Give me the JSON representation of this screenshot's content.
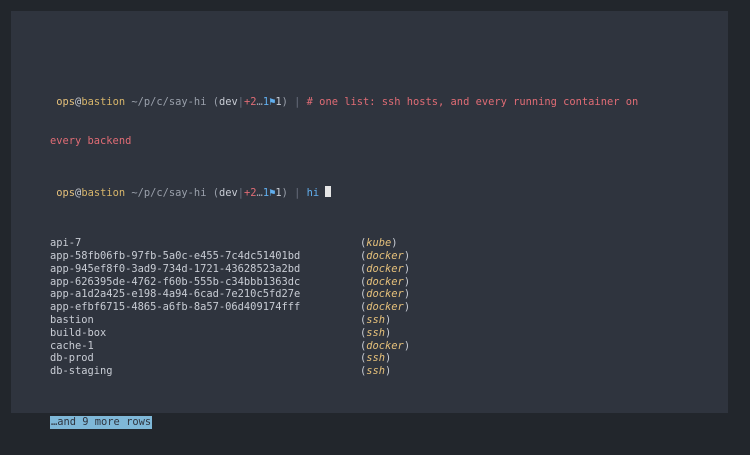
{
  "prompt1": {
    "user": "ops",
    "at": "@",
    "host": "bastion",
    "path": "~/p/c/say-hi",
    "branch": "dev",
    "ahead": "+2",
    "dots": "…",
    "behind": "1",
    "staged": "1",
    "pipe": "|",
    "comment": "# one list: ssh hosts, and every running container on",
    "comment_wrap": "every backend"
  },
  "prompt2": {
    "user": "ops",
    "at": "@",
    "host": "bastion",
    "path": "~/p/c/say-hi",
    "branch": "dev",
    "ahead": "+2",
    "dots": "…",
    "behind": "1",
    "staged": "1",
    "pipe": "|",
    "command": "hi"
  },
  "rows": [
    {
      "name": "api-7",
      "type": "kube"
    },
    {
      "name": "app-58fb06fb-97fb-5a0c-e455-7c4dc51401bd",
      "type": "docker"
    },
    {
      "name": "app-945ef8f0-3ad9-734d-1721-43628523a2bd",
      "type": "docker"
    },
    {
      "name": "app-626395de-4762-f60b-555b-c34bbb1363dc",
      "type": "docker"
    },
    {
      "name": "app-a1d2a425-e198-4a94-6cad-7e210c5fd27e",
      "type": "docker"
    },
    {
      "name": "app-efbf6715-4865-a6fb-8a57-06d409174fff",
      "type": "docker"
    },
    {
      "name": "bastion",
      "type": "ssh"
    },
    {
      "name": "build-box",
      "type": "ssh"
    },
    {
      "name": "cache-1",
      "type": "docker"
    },
    {
      "name": "db-prod",
      "type": "ssh"
    },
    {
      "name": "db-staging",
      "type": "ssh"
    }
  ],
  "more_rows": "…and 9 more rows",
  "colors": {
    "background": "#22262c",
    "terminal": "#2f343e",
    "user": "#e5c07b",
    "comment": "#e06c75",
    "command": "#61afef",
    "highlight": "#7fb8d8"
  }
}
